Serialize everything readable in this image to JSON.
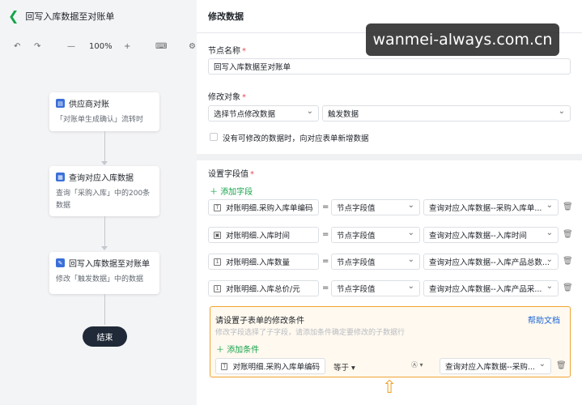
{
  "flow": {
    "title": "回写入库数据至对账单",
    "zoom": "100%",
    "nodes": [
      {
        "title": "供应商对账",
        "desc": "「对账单生成确认」流转时"
      },
      {
        "title": "查询对应入库数据",
        "desc": "查询「采购入库」中的200条数据"
      },
      {
        "title": "回写入库数据至对账单",
        "desc": "修改「触发数据」中的数据"
      }
    ],
    "end_label": "结束"
  },
  "panel": {
    "title": "修改数据",
    "node_name_label": "节点名称",
    "node_name_value": "回写入库数据至对账单",
    "target_label": "修改对象",
    "target_select1": "选择节点修改数据",
    "target_select2": "触发数据",
    "checkbox_label": "没有可修改的数据时，向对应表单新增数据",
    "fields_label": "设置字段值",
    "add_field": "添加字段",
    "fields": [
      {
        "icon": "field-text-icon",
        "name": "对账明细.采购入库单编码",
        "op": "=",
        "type": "节点字段值",
        "value": "查询对应入库数据--采购入库单..."
      },
      {
        "icon": "field-date-icon",
        "name": "对账明细.入库时间",
        "op": "=",
        "type": "节点字段值",
        "value": "查询对应入库数据--入库时间"
      },
      {
        "icon": "field-number-icon",
        "name": "对账明细.入库数量",
        "op": "=",
        "type": "节点字段值",
        "value": "查询对应入库数据--入库产品总数..."
      },
      {
        "icon": "field-number-icon",
        "name": "对账明细.入库总价/元",
        "op": "=",
        "type": "节点字段值",
        "value": "查询对应入库数据--入库产品采..."
      }
    ],
    "sub": {
      "title": "请设置子表单的修改条件",
      "desc": "修改字段选择了子字段，请添加条件确定要修改的子数据行",
      "help": "帮助文档",
      "add_condition": "添加条件",
      "cond_field": "对账明细.采购入库单编码",
      "cond_op": "等于",
      "cond_value": "查询对应入库数据--采购..."
    }
  },
  "watermark": "wanmei-always.com.cn",
  "colors": {
    "accent": "#16a34a",
    "link": "#1e66d6",
    "highlight": "#f0a431"
  }
}
